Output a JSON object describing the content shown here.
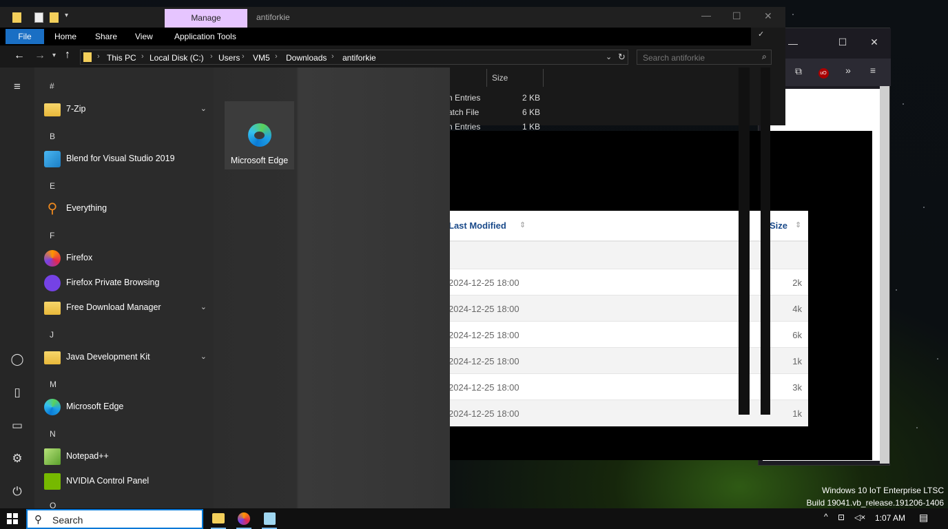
{
  "explorer": {
    "title": "antiforkie",
    "manage_tab": "Manage",
    "ribbon_tabs": [
      "File",
      "Home",
      "Share",
      "View",
      "Application Tools"
    ],
    "breadcrumb": [
      "This PC",
      "Local Disk (C:)",
      "Users",
      "VM5",
      "Downloads",
      "antiforkie"
    ],
    "search_placeholder": "Search antiforkie",
    "list": {
      "size_header": "Size",
      "rows": [
        {
          "type": "n Entries",
          "size": "2 KB"
        },
        {
          "type": "atch File",
          "size": "6 KB"
        },
        {
          "type": "n Entries",
          "size": "1 KB"
        }
      ]
    }
  },
  "web": {
    "col_last_modified": "Last Modified",
    "col_size": "Size",
    "rows": [
      {
        "date": "2024-12-25 18:00",
        "size": "2k"
      },
      {
        "date": "2024-12-25 18:00",
        "size": "4k"
      },
      {
        "date": "2024-12-25 18:00",
        "size": "6k"
      },
      {
        "date": "2024-12-25 18:00",
        "size": "1k"
      },
      {
        "date": "2024-12-25 18:00",
        "size": "3k"
      },
      {
        "date": "2024-12-25 18:00",
        "size": "1k"
      }
    ]
  },
  "start_menu": {
    "groups": [
      {
        "letter": "#",
        "apps": [
          {
            "label": "7-Zip",
            "icon": "folder-icon",
            "expand": true
          }
        ]
      },
      {
        "letter": "B",
        "apps": [
          {
            "label": "Blend for Visual Studio 2019",
            "icon": "blend-icon",
            "expand": false
          }
        ]
      },
      {
        "letter": "E",
        "apps": [
          {
            "label": "Everything",
            "icon": "magnifier-icon",
            "expand": false
          }
        ]
      },
      {
        "letter": "F",
        "apps": [
          {
            "label": "Firefox",
            "icon": "firefox-icon",
            "expand": false
          },
          {
            "label": "Firefox Private Browsing",
            "icon": "firefox-private-icon",
            "expand": false
          },
          {
            "label": "Free Download Manager",
            "icon": "folder-icon",
            "expand": true
          }
        ]
      },
      {
        "letter": "J",
        "apps": [
          {
            "label": "Java Development Kit",
            "icon": "folder-icon",
            "expand": true
          }
        ]
      },
      {
        "letter": "M",
        "apps": [
          {
            "label": "Microsoft Edge",
            "icon": "edge-icon",
            "expand": false
          }
        ]
      },
      {
        "letter": "N",
        "apps": [
          {
            "label": "Notepad++",
            "icon": "notepadpp-icon",
            "expand": false
          },
          {
            "label": "NVIDIA Control Panel",
            "icon": "nvidia-icon",
            "expand": false
          }
        ]
      },
      {
        "letter": "O",
        "apps": []
      }
    ],
    "tile_edge_label": "Microsoft Edge"
  },
  "taskbar": {
    "search_label": "Search",
    "time": "1:07 AM"
  },
  "watermark": {
    "line1": "Windows 10 IoT Enterprise LTSC",
    "line2": "Build 19041.vb_release.191206-1406"
  },
  "colors": {
    "accent": "#0078d7",
    "manage_tab": "#e6c5ff",
    "file_tab": "#1a6fc4",
    "link_header": "#1a4a8a"
  }
}
